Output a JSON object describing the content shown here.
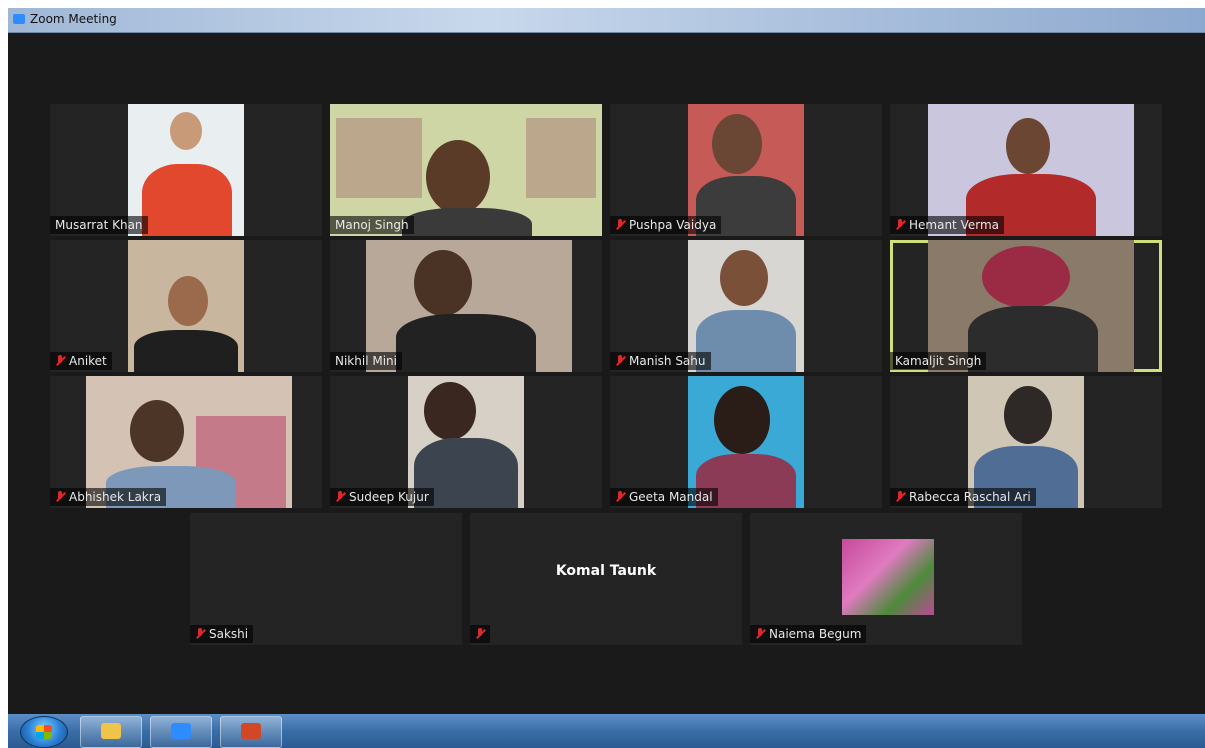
{
  "window": {
    "title": "Zoom Meeting"
  },
  "participants": [
    {
      "name": "Musarrat Khan",
      "muted": false
    },
    {
      "name": "Manoj Singh",
      "muted": false
    },
    {
      "name": "Pushpa Vaidya",
      "muted": true
    },
    {
      "name": "Hemant Verma",
      "muted": true
    },
    {
      "name": "Aniket",
      "muted": true
    },
    {
      "name": "Nikhil Mini",
      "muted": false
    },
    {
      "name": "Manish Sahu",
      "muted": true
    },
    {
      "name": "Kamaljit Singh",
      "muted": false,
      "active_speaker": true
    },
    {
      "name": "Abhishek Lakra",
      "muted": true
    },
    {
      "name": "Sudeep Kujur",
      "muted": true
    },
    {
      "name": "Geeta Mandal",
      "muted": true
    },
    {
      "name": "Rabecca Raschal Ari",
      "muted": true
    },
    {
      "name": "Sakshi",
      "muted": true
    },
    {
      "name": "Komal Taunk",
      "muted": true,
      "video_off": true
    },
    {
      "name": "Naiema Begum",
      "muted": true
    }
  ],
  "taskbar": {
    "items": [
      "start-button",
      "file-explorer",
      "zoom",
      "powerpoint"
    ]
  },
  "colors": {
    "active_speaker_border": "#cfe07a",
    "muted_icon": "#e02828",
    "stage_background": "#1a1a1a"
  }
}
